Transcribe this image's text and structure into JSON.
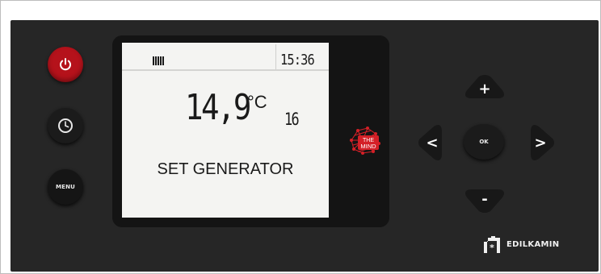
{
  "panel": {
    "buttons": {
      "power_icon": "power-icon",
      "clock_icon": "clock-icon",
      "menu_label": "MENU"
    },
    "display": {
      "status_bars_icon": "bar-indicator-icon",
      "time": "15:36",
      "temperature": "14,9",
      "temperature_unit": "°C",
      "secondary_value": "16",
      "message": "SET GENERATOR"
    },
    "mind_logo": {
      "line1": "THE",
      "line2": "MIND"
    },
    "navigation": {
      "up_label": "+",
      "down_label": "-",
      "left_label": "<",
      "right_label": ">",
      "ok_label": "OK"
    },
    "brand": {
      "name": "EDILKAMIN"
    }
  },
  "colors": {
    "panel_background": "#262626",
    "power_red": "#b5121b",
    "mind_red": "#d42027",
    "lcd_background": "#f4f4f2"
  }
}
